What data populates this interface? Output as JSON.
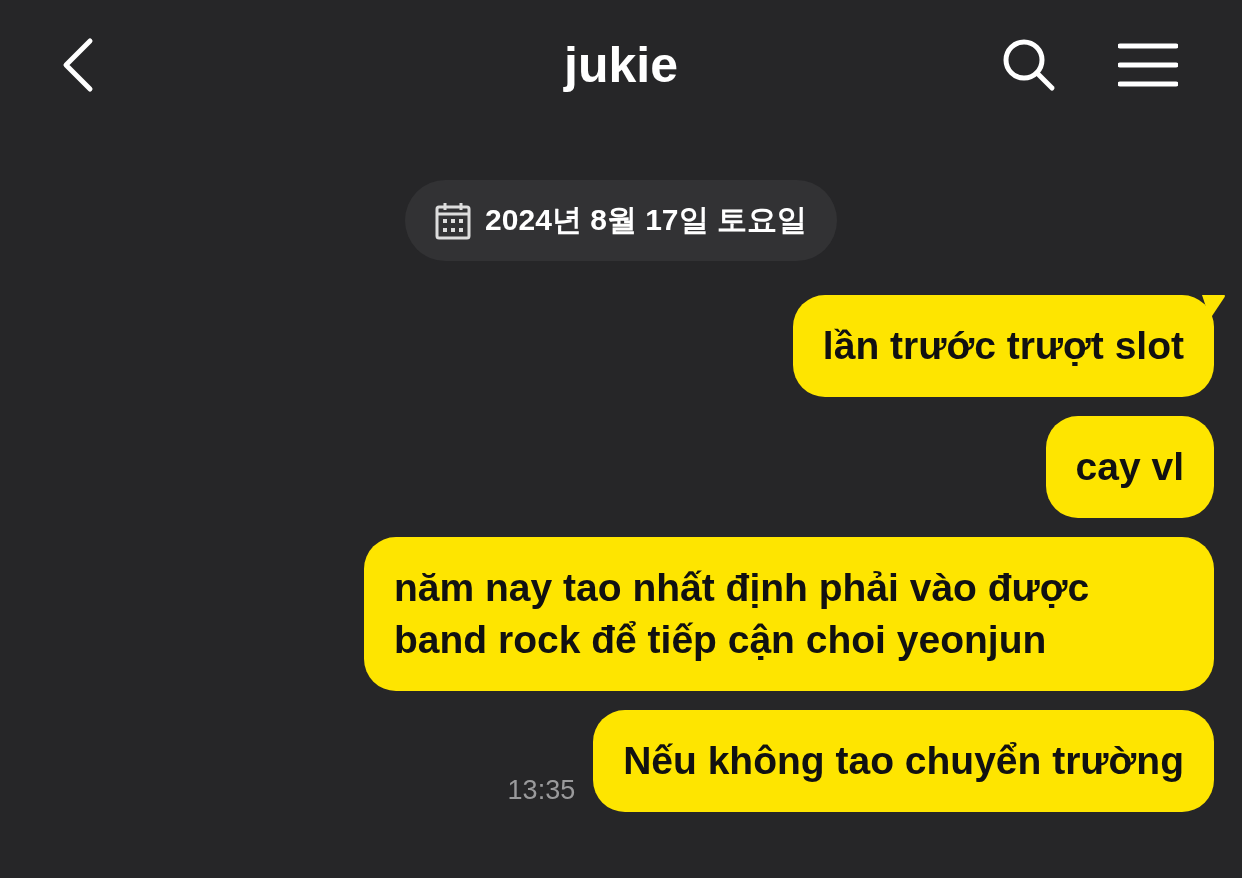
{
  "header": {
    "title": "jukie"
  },
  "date": "2024년 8월 17일 토요일",
  "messages": [
    {
      "text": "lần trước trượt slot",
      "tail": true
    },
    {
      "text": "cay vl",
      "tail": false
    },
    {
      "text": "năm nay tao nhất định phải vào được band rock để tiếp cận choi yeonjun",
      "tail": false
    },
    {
      "text": "Nếu không tao chuyển trường",
      "tail": false
    }
  ],
  "time": "13:35"
}
